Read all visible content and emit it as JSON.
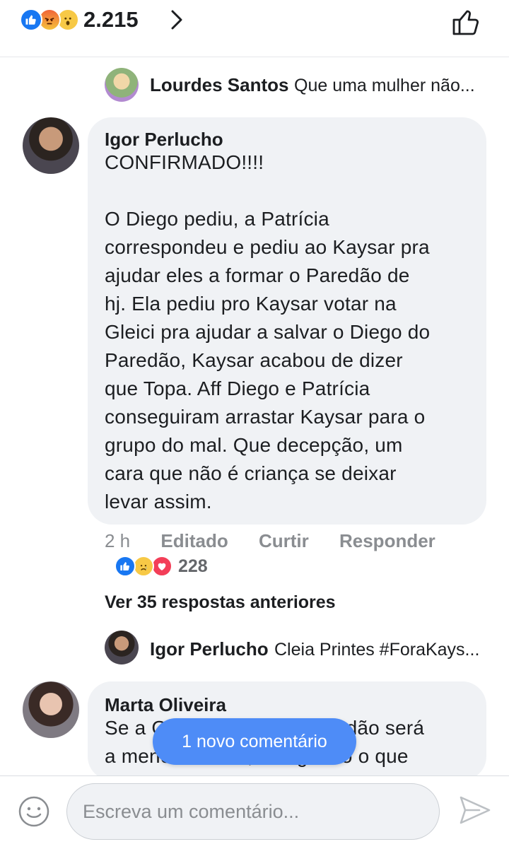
{
  "header": {
    "reaction_icons": [
      "like-icon",
      "angry-icon",
      "wow-icon"
    ],
    "reaction_count": "2.215"
  },
  "top_reply": {
    "author": "Lourdes Santos",
    "text": "Que uma mulher não..."
  },
  "main_comment": {
    "author": "Igor Perlucho",
    "body": "CONFIRMADO!!!!\n\nO Diego pediu, a Patrícia\ncorrespondeu e pediu ao Kaysar pra\najudar eles a formar o Paredão de\nhj. Ela pediu pro Kaysar votar na\nGleici pra ajudar a salvar o Diego do\nParedão, Kaysar acabou de dizer\nque Topa. Aff Diego e Patrícia\nconseguiram arrastar Kaysar para o\ngrupo do mal. Que decepção, um\ncara que não é criança se deixar\nlevar assim.",
    "time": "2 h",
    "edited_label": "Editado",
    "like_label": "Curtir",
    "reply_label": "Responder",
    "reaction_icons": [
      "like-icon",
      "sad-icon",
      "love-icon"
    ],
    "reaction_count": "228"
  },
  "view_previous": "Ver 35 respostas anteriores",
  "nested_reply": {
    "author": "Igor Perlucho",
    "text": "Cleia Printes #ForaKays..."
  },
  "second_comment": {
    "author": "Marta Oliveira",
    "body": "Se a Gleice for para o paredão será\na menos votada, e segundo o que"
  },
  "new_comment_pill": "1 novo comentário",
  "composer": {
    "placeholder": "Escreva um comentário..."
  },
  "colors": {
    "accent": "#1877f2",
    "bubble": "#f0f2f5",
    "pill": "#4e8cf7",
    "muted": "#8a8d91"
  }
}
